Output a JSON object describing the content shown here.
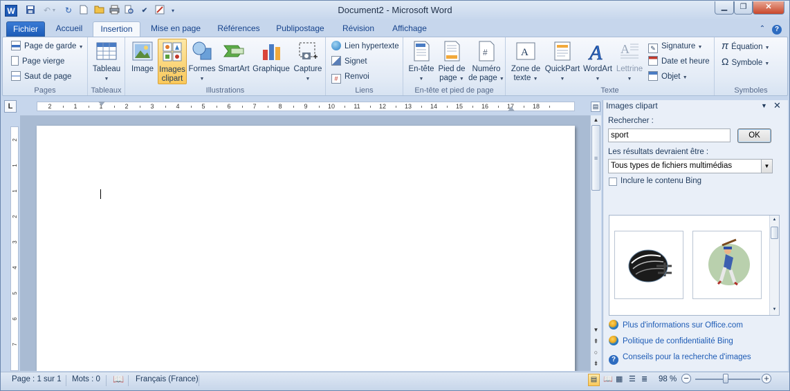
{
  "window": {
    "title": "Document2 - Microsoft Word"
  },
  "tabs": [
    "Fichier",
    "Accueil",
    "Insertion",
    "Mise en page",
    "Références",
    "Publipostage",
    "Révision",
    "Affichage"
  ],
  "ribbon": {
    "pages": {
      "label": "Pages",
      "items": [
        "Page de garde",
        "Page vierge",
        "Saut de page"
      ]
    },
    "tableaux": {
      "label": "Tableaux",
      "table": "Tableau"
    },
    "illustrations": {
      "label": "Illustrations",
      "image": "Image",
      "clipart_1": "Images",
      "clipart_2": "clipart",
      "formes": "Formes",
      "smartart": "SmartArt",
      "graphique": "Graphique",
      "capture": "Capture"
    },
    "liens": {
      "label": "Liens",
      "items": [
        "Lien hypertexte",
        "Signet",
        "Renvoi"
      ]
    },
    "entete": {
      "label": "En-tête et pied de page",
      "entete": "En-tête",
      "pied_1": "Pied de",
      "pied_2": "page",
      "numero_1": "Numéro",
      "numero_2": "de page"
    },
    "texte": {
      "label": "Texte",
      "zone_1": "Zone de",
      "zone_2": "texte",
      "quickpart": "QuickPart",
      "wordart": "WordArt",
      "lettrine": "Lettrine",
      "items": [
        "Signature",
        "Date et heure",
        "Objet"
      ]
    },
    "symboles": {
      "label": "Symboles",
      "items": [
        "Équation",
        "Symbole"
      ]
    }
  },
  "ruler": {
    "corner": "L",
    "numbers": [
      "2",
      "1",
      "1",
      "2",
      "3",
      "4",
      "5",
      "6",
      "7",
      "8",
      "9",
      "10",
      "11",
      "12",
      "13",
      "14",
      "15",
      "16",
      "17",
      "18"
    ],
    "vnumbers": [
      "2",
      "1",
      "1",
      "2",
      "3",
      "4",
      "5",
      "6",
      "7"
    ]
  },
  "clipart_pane": {
    "title": "Images clipart",
    "search_label": "Rechercher :",
    "search_value": "sport",
    "ok_label": "OK",
    "results_label": "Les résultats devraient être :",
    "results_type": "Tous types de fichiers multimédias",
    "bing_label": "Inclure le contenu Bing",
    "links": [
      "Plus d'informations sur Office.com",
      "Politique de confidentialité Bing",
      "Conseils pour la recherche d'images"
    ]
  },
  "statusbar": {
    "page": "Page : 1 sur 1",
    "words": "Mots : 0",
    "language": "Français (France)",
    "zoom": "98 %"
  },
  "colors": {
    "file_tab": "#1d5cb8",
    "link": "#1d5bb5",
    "window_bg": "#c6d6ec"
  }
}
